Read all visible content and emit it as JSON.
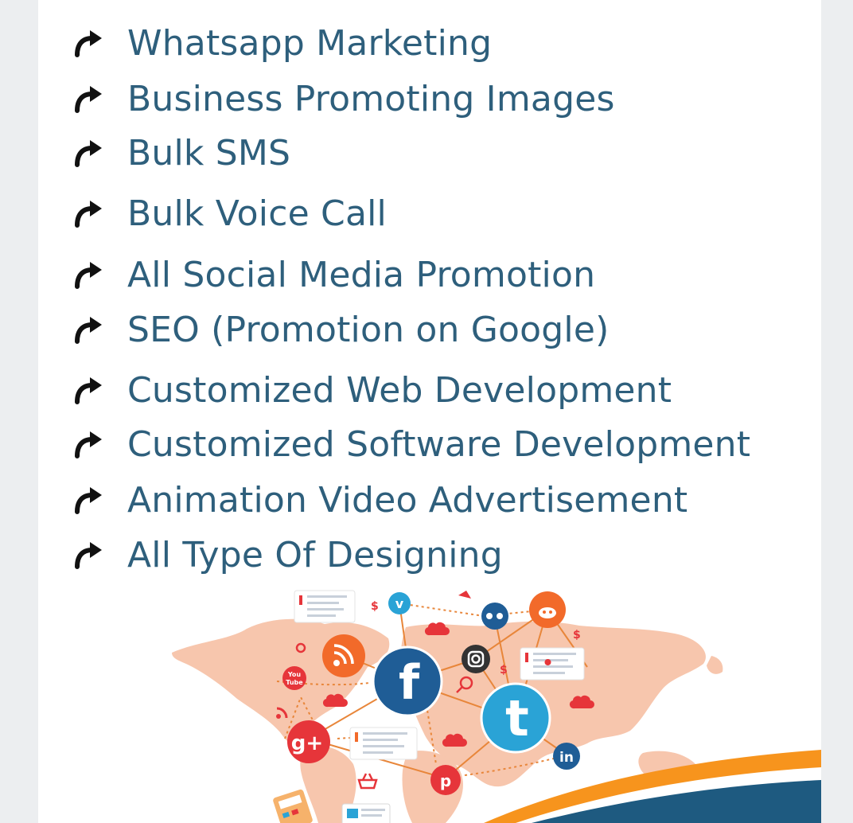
{
  "services": [
    {
      "label": "Whatsapp Marketing",
      "icon": "curved-arrow-icon"
    },
    {
      "label": "Business Promoting Images",
      "icon": "curved-arrow-icon"
    },
    {
      "label": "Bulk SMS",
      "icon": "curved-arrow-icon"
    },
    {
      "label": "Bulk Voice Call",
      "icon": "curved-arrow-icon"
    },
    {
      "label": "All Social Media Promotion",
      "icon": "curved-arrow-icon"
    },
    {
      "label": "SEO (Promotion on Google)",
      "icon": "curved-arrow-icon"
    },
    {
      "label": "Customized Web Development",
      "icon": "curved-arrow-icon"
    },
    {
      "label": "Customized Software Development",
      "icon": "curved-arrow-icon"
    },
    {
      "label": "Animation Video Advertisement",
      "icon": "curved-arrow-icon"
    },
    {
      "label": "All Type Of Designing",
      "icon": "curved-arrow-icon"
    }
  ],
  "illustration": {
    "icons": {
      "facebook": "f",
      "twitter": "t",
      "google_plus": "g+",
      "linkedin": "in",
      "pinterest": "p",
      "vimeo": "v",
      "youtube_line1": "You",
      "youtube_line2": "Tube",
      "currency": "$"
    }
  },
  "colors": {
    "text": "#2e5f7c",
    "map": "#f7c6ad",
    "facebook": "#1f5d96",
    "twitter": "#2aa3d6",
    "orange": "#f26a2a",
    "red": "#e6353a",
    "wave_orange": "#f7941d",
    "wave_blue": "#1e5a80"
  }
}
